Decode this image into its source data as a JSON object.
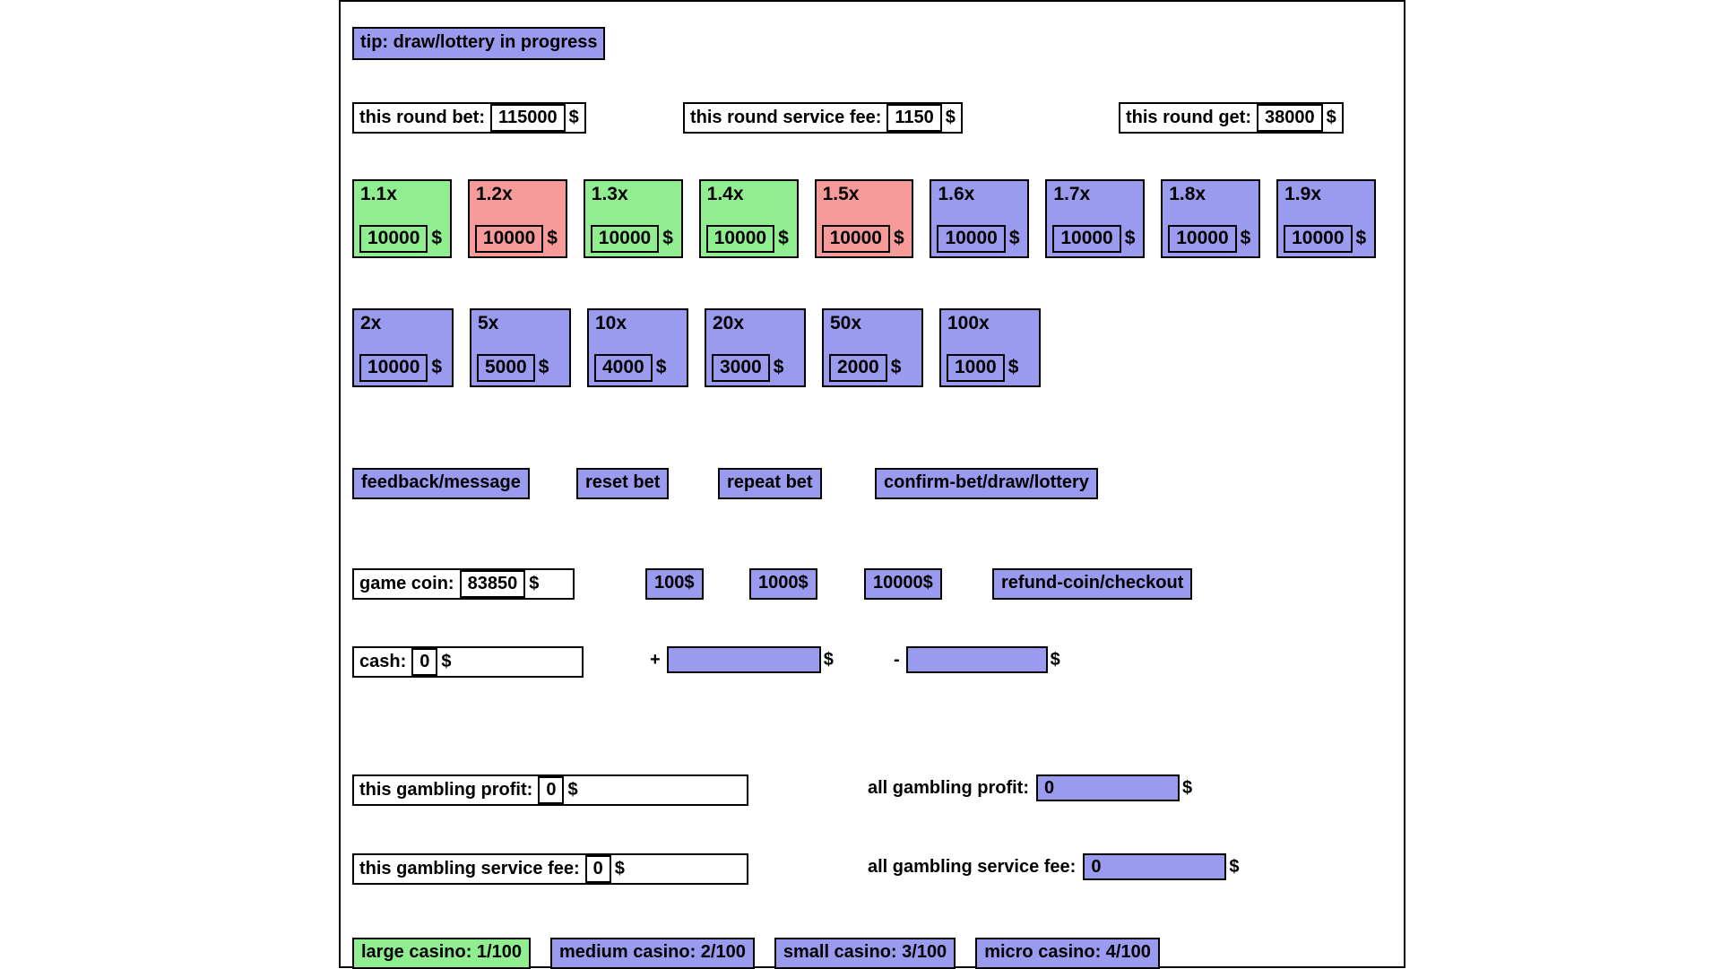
{
  "colors": {
    "purple": "#9a9aef",
    "green": "#90ee90",
    "red": "#f79a9a",
    "border": "#000000",
    "background": "#ffffff"
  },
  "tip": {
    "text": "tip: draw/lottery in progress"
  },
  "round": {
    "bet": {
      "label": "this round bet:",
      "value": "115000",
      "unit": "$"
    },
    "service_fee": {
      "label": "this round service fee:",
      "value": "1150",
      "unit": "$"
    },
    "get": {
      "label": "this round get:",
      "value": "38000",
      "unit": "$"
    }
  },
  "bet_cards_row1": [
    {
      "multiplier": "1.1x",
      "amount": "10000",
      "unit": "$",
      "state": "green"
    },
    {
      "multiplier": "1.2x",
      "amount": "10000",
      "unit": "$",
      "state": "red"
    },
    {
      "multiplier": "1.3x",
      "amount": "10000",
      "unit": "$",
      "state": "green"
    },
    {
      "multiplier": "1.4x",
      "amount": "10000",
      "unit": "$",
      "state": "green"
    },
    {
      "multiplier": "1.5x",
      "amount": "10000",
      "unit": "$",
      "state": "red"
    },
    {
      "multiplier": "1.6x",
      "amount": "10000",
      "unit": "$",
      "state": "purple"
    },
    {
      "multiplier": "1.7x",
      "amount": "10000",
      "unit": "$",
      "state": "purple"
    },
    {
      "multiplier": "1.8x",
      "amount": "10000",
      "unit": "$",
      "state": "purple"
    },
    {
      "multiplier": "1.9x",
      "amount": "10000",
      "unit": "$",
      "state": "purple"
    }
  ],
  "bet_cards_row2": [
    {
      "multiplier": "2x",
      "amount": "10000",
      "unit": "$",
      "state": "purple"
    },
    {
      "multiplier": "5x",
      "amount": "5000",
      "unit": "$",
      "state": "purple"
    },
    {
      "multiplier": "10x",
      "amount": "4000",
      "unit": "$",
      "state": "purple"
    },
    {
      "multiplier": "20x",
      "amount": "3000",
      "unit": "$",
      "state": "purple"
    },
    {
      "multiplier": "50x",
      "amount": "2000",
      "unit": "$",
      "state": "purple"
    },
    {
      "multiplier": "100x",
      "amount": "1000",
      "unit": "$",
      "state": "purple"
    }
  ],
  "actions": {
    "feedback": "feedback/message",
    "reset_bet": "reset bet",
    "repeat_bet": "repeat bet",
    "confirm_bet": "confirm-bet/draw/lottery"
  },
  "coin": {
    "label": "game coin:",
    "value": "83850",
    "unit": "$",
    "quick_add": [
      "100$",
      "1000$",
      "10000$"
    ],
    "refund": "refund-coin/checkout"
  },
  "cash": {
    "label": "cash:",
    "value": "0",
    "unit": "$",
    "add_sign": "+",
    "add_value": "",
    "add_unit": "$",
    "sub_sign": "-",
    "sub_value": "",
    "sub_unit": "$"
  },
  "stats": {
    "this_profit": {
      "label": "this gambling profit:",
      "value": "0",
      "unit": "$"
    },
    "all_profit": {
      "label": "all gambling profit:",
      "value": "0",
      "unit": "$"
    },
    "this_service_fee": {
      "label": "this gambling service fee:",
      "value": "0",
      "unit": "$"
    },
    "all_service_fee": {
      "label": "all gambling service fee:",
      "value": "0",
      "unit": "$"
    }
  },
  "casinos": [
    {
      "label": "large casino: 1/100",
      "state": "green"
    },
    {
      "label": "medium casino: 2/100",
      "state": "purple"
    },
    {
      "label": "small casino: 3/100",
      "state": "purple"
    },
    {
      "label": "micro casino: 4/100",
      "state": "purple"
    }
  ]
}
